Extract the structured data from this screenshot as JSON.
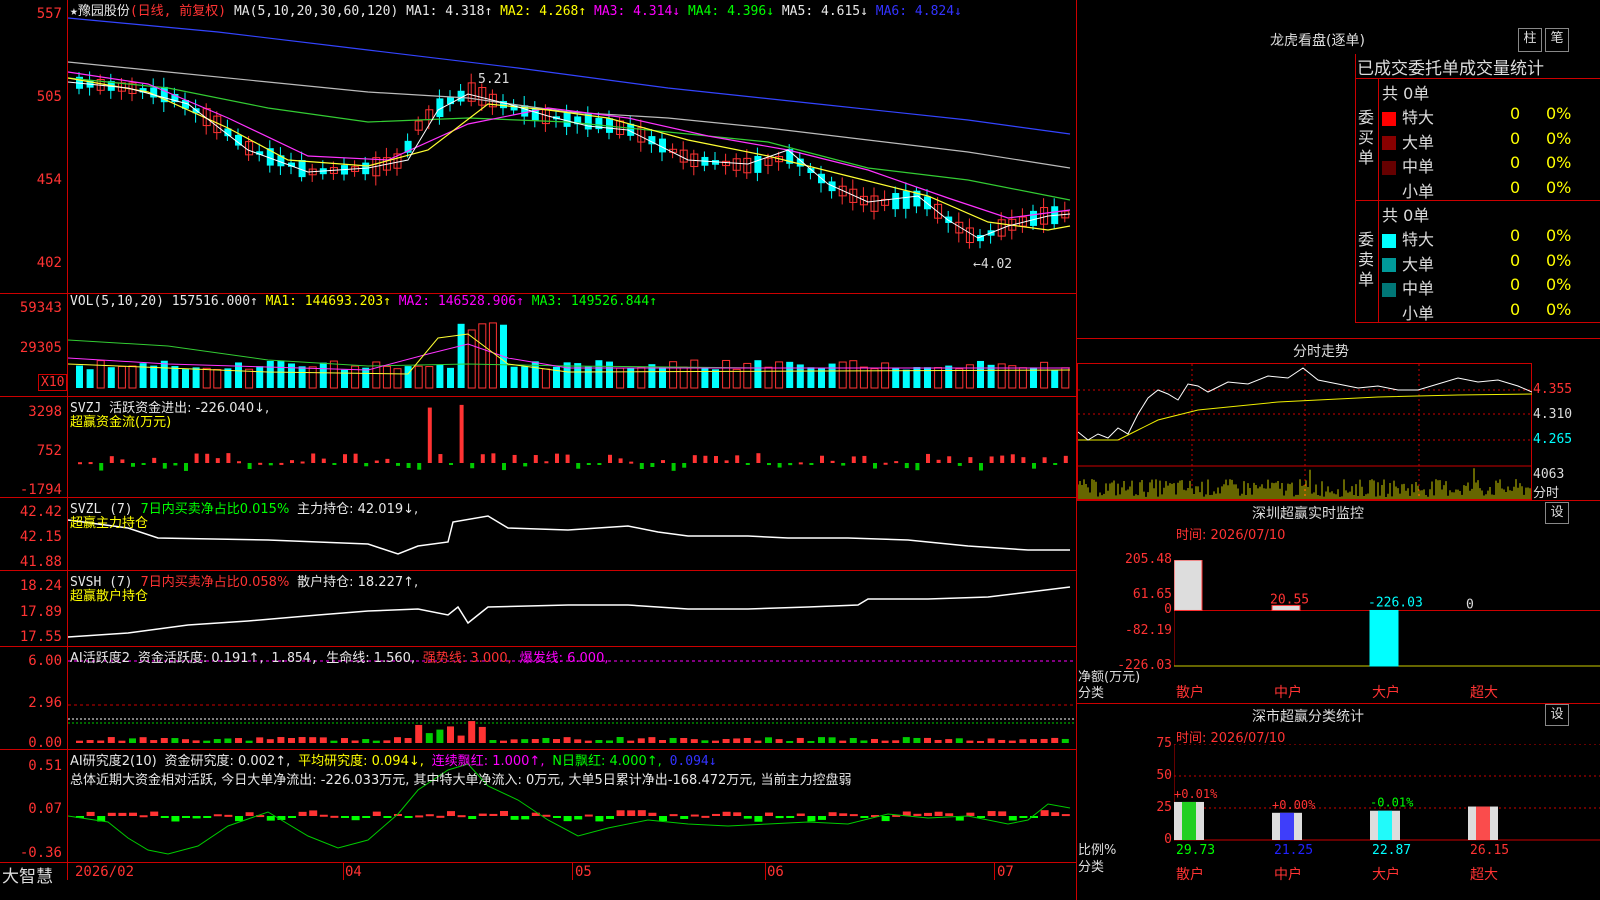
{
  "main": {
    "legend": {
      "name": "★豫园股份",
      "mode": "(日线, 前复权)",
      "ma_spec": "MA(5,10,20,30,60,120)",
      "ma1": "MA1: 4.318↑",
      "ma2": "MA2: 4.268↑",
      "ma3": "MA3: 4.314↓",
      "ma4": "MA4: 4.396↓",
      "ma5": "MA5: 4.615↓",
      "ma6": "MA6: 4.824↓"
    },
    "yticks": [
      "557",
      "505",
      "454",
      "402"
    ],
    "high_label": "5.21",
    "low_label": "←4.02"
  },
  "vol": {
    "legend": {
      "name": "VOL(5,10,20)",
      "val": "157516.000↑",
      "ma1": "MA1: 144693.203↑",
      "ma2": "MA2: 146528.906↑",
      "ma3": "MA3: 149526.844↑"
    },
    "yticks": [
      "59343",
      "29305"
    ],
    "unit": "X10"
  },
  "svzj": {
    "legend": {
      "name": "SVZJ",
      "desc": "活跃资金进出: -226.040↓,",
      "sub": "超赢资金流(万元)"
    },
    "yticks": [
      "3298",
      "752",
      "-1794"
    ]
  },
  "svzl": {
    "legend": {
      "name": "SVZL (7)",
      "desc": "7日内买卖净占比0.015%",
      "hold": "主力持仓: 42.019↓,",
      "sub": "超赢主力持仓"
    },
    "yticks": [
      "42.42",
      "42.15",
      "41.88"
    ]
  },
  "svsh": {
    "legend": {
      "name": "SVSH (7)",
      "desc": "7日内买卖净占比0.058%",
      "hold": "散户持仓: 18.227↑,",
      "sub": "超赢散户持仓"
    },
    "yticks": [
      "18.24",
      "17.89",
      "17.55"
    ]
  },
  "ai1": {
    "legend": {
      "name": "AI活跃度2",
      "a": "资金活跃度: 0.191↑,",
      "b": "1.854,",
      "c": "生命线: 1.560,",
      "d": "强势线: 3.000,",
      "e": "爆发线: 6.000,"
    },
    "yticks": [
      "6.00",
      "2.96",
      "0.00"
    ]
  },
  "ai2": {
    "legend": {
      "name": "AI研究度2(10)",
      "a": "资金研究度: 0.002↑,",
      "b": "平均研究度: 0.094↓,",
      "c": "连续飘红: 1.000↑,",
      "d": "N日飘红: 4.000↑,",
      "e": "0.094↓"
    },
    "summary": "总体近期大资金相对活跃, 今日大单净流出: -226.033万元, 其中特大单净流入: 0万元, 大单5日累计净出-168.472万元, 当前主力控盘弱",
    "yticks": [
      "0.51",
      "0.07",
      "-0.36"
    ]
  },
  "xaxis": {
    "brand": "大智慧",
    "labels": [
      "2026/02",
      "04",
      "05",
      "06",
      "07"
    ]
  },
  "right": {
    "dragon": {
      "title": "龙虎看盘(逐单)",
      "btn1": "柱",
      "btn2": "笔",
      "subtitle": "已成交委托单成交量统计",
      "buy_label": "委买单",
      "sell_label": "委卖单",
      "buy_total": "共 0单",
      "sell_total": "共 0单",
      "buy_rows": [
        {
          "name": "特大",
          "val": "0",
          "pct": "0%"
        },
        {
          "name": "大单",
          "val": "0",
          "pct": "0%"
        },
        {
          "name": "中单",
          "val": "0",
          "pct": "0%"
        },
        {
          "name": "小单",
          "val": "0",
          "pct": "0%"
        }
      ],
      "sell_rows": [
        {
          "name": "特大",
          "val": "0",
          "pct": "0%"
        },
        {
          "name": "大单",
          "val": "0",
          "pct": "0%"
        },
        {
          "name": "中单",
          "val": "0",
          "pct": "0%"
        },
        {
          "name": "小单",
          "val": "0",
          "pct": "0%"
        }
      ]
    },
    "intraday": {
      "title": "分时走势",
      "yticks": [
        "4.355",
        "4.310",
        "4.265"
      ],
      "vol_tick": "4063",
      "vol_unit": "分时"
    },
    "monitor": {
      "title": "深圳超赢实时监控",
      "btn": "设",
      "time": "时间: 2026/07/10",
      "yticks": [
        "205.48",
        "61.65",
        "0",
        "-82.19",
        "-226.03"
      ],
      "ylabel": "净额(万元)",
      "xlabel": "分类",
      "bars": [
        {
          "cat": "散户",
          "value": 205.48,
          "label": "205.48"
        },
        {
          "cat": "中户",
          "value": 20.55,
          "label": "20.55"
        },
        {
          "cat": "大户",
          "value": -226.03,
          "label": "-226.03"
        },
        {
          "cat": "超大",
          "value": 0,
          "label": "0"
        }
      ]
    },
    "classify": {
      "title": "深市超赢分类统计",
      "btn": "设",
      "time": "时间: 2026/07/10",
      "yticks": [
        "75",
        "50",
        "25",
        "0"
      ],
      "ylabel": "比例%",
      "xlabel": "分类",
      "bars": [
        {
          "cat": "散户",
          "value": 29.73,
          "label": "29.73",
          "delta": "+0.01%"
        },
        {
          "cat": "中户",
          "value": 21.25,
          "label": "21.25",
          "delta": "+0.00%"
        },
        {
          "cat": "大户",
          "value": 22.87,
          "label": "22.87",
          "delta": "-0.01%"
        },
        {
          "cat": "超大",
          "value": 26.15,
          "label": "26.15",
          "delta": ""
        }
      ]
    }
  },
  "colors": {
    "up": "#ff3333",
    "down": "#00ffff",
    "grid": "#cc0000"
  }
}
